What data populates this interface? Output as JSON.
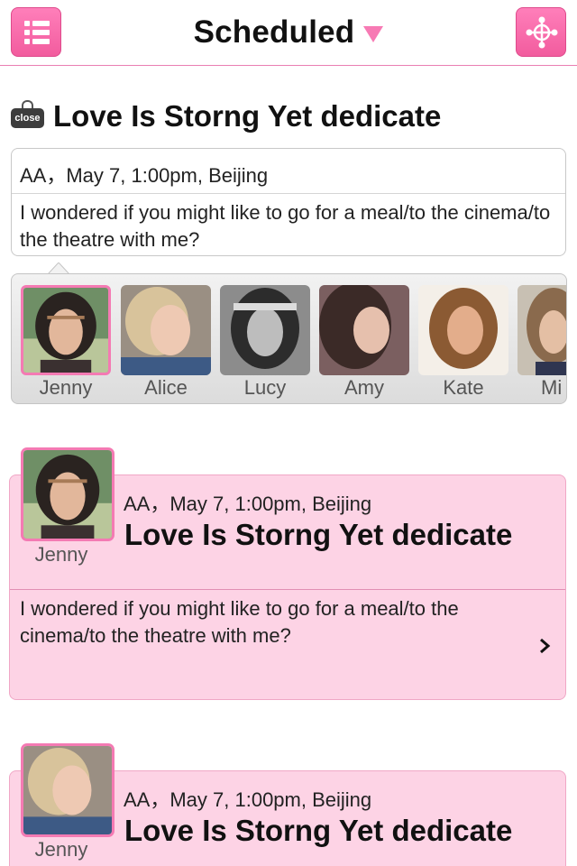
{
  "header": {
    "title": "Scheduled",
    "menu_icon": "list-menu-icon",
    "share_icon": "share-network-icon",
    "accent": "#f25c9e"
  },
  "compose": {
    "close_label": "close",
    "title": "Love Is Storng Yet dedicate",
    "meta": "AA，May 7, 1:00pm, Beijing",
    "message": "I wondered if you might like to go for a meal/to the cinema/to the theatre with me?"
  },
  "contacts": [
    {
      "name": "Jenny",
      "selected": true
    },
    {
      "name": "Alice",
      "selected": false
    },
    {
      "name": "Lucy",
      "selected": false
    },
    {
      "name": "Amy",
      "selected": false
    },
    {
      "name": "Kate",
      "selected": false
    },
    {
      "name": "Mi",
      "selected": false
    }
  ],
  "messages": [
    {
      "avatar_name": "Jenny",
      "meta": "AA，May 7, 1:00pm, Beijing",
      "title": "Love Is Storng Yet dedicate",
      "body": "I wondered if you might like to go for a meal/to the cinema/to the theatre with me?"
    },
    {
      "avatar_name": "Jenny",
      "meta": "AA，May 7, 1:00pm, Beijing",
      "title": "Love Is Storng Yet dedicate",
      "body": ""
    }
  ]
}
